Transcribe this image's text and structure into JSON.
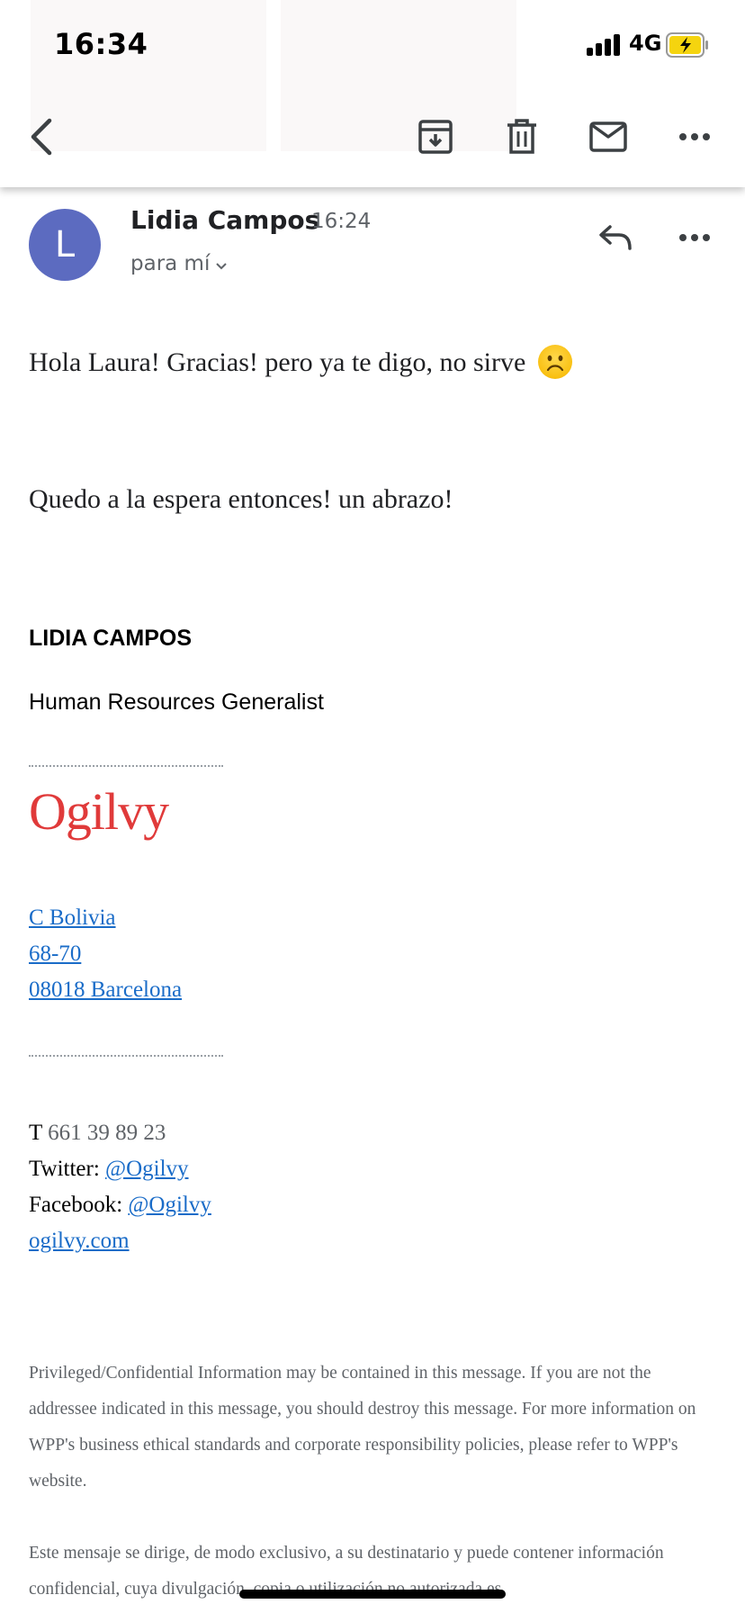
{
  "status_bar": {
    "time": "16:34",
    "network": "4G"
  },
  "toolbar": {
    "back_icon": "chevron-left-icon",
    "archive_icon": "archive-icon",
    "delete_icon": "trash-icon",
    "mark_unread_icon": "mail-icon",
    "more_icon": "more-horizontal-icon"
  },
  "message": {
    "avatar_letter": "L",
    "avatar_color": "#5c6bc0",
    "sender": "Lidia Campos",
    "time": "16:24",
    "recipient": "para mí",
    "reply_icon": "reply-icon",
    "more_icon": "more-horizontal-icon"
  },
  "body": {
    "line1": "Hola Laura! Gracias! pero ya te digo, no sirve",
    "line1_emoji": "frowning-face-emoji",
    "line2": "Quedo a la espera entonces! un abrazo!"
  },
  "signature": {
    "name": "LIDIA CAMPOS",
    "role": "Human Resources Generalist",
    "logo": "Ogilvy",
    "address": [
      "C Bolivia",
      "68-70",
      "08018 Barcelona"
    ],
    "phone_label": "T",
    "phone": "661 39 89 23",
    "twitter_label": "Twitter:",
    "twitter": "@Ogilvy",
    "facebook_label": "Facebook:",
    "facebook": "@Ogilvy",
    "website": "ogilvy.com"
  },
  "legal": {
    "en": "Privileged/Confidential Information may be contained in this message. If you are not the addressee indicated in this message, you should destroy this message. For more information on WPP's business ethical standards and corporate responsibility policies, please refer to WPP's website.",
    "es": "Este mensaje se dirige, de modo exclusivo, a su destinatario y puede contener información confidencial, cuya divulgación, copia o utilización no autorizada es"
  },
  "colors": {
    "link": "#1a6cc8",
    "logo": "#e03a3a",
    "battery_fill": "#f5d40f"
  }
}
